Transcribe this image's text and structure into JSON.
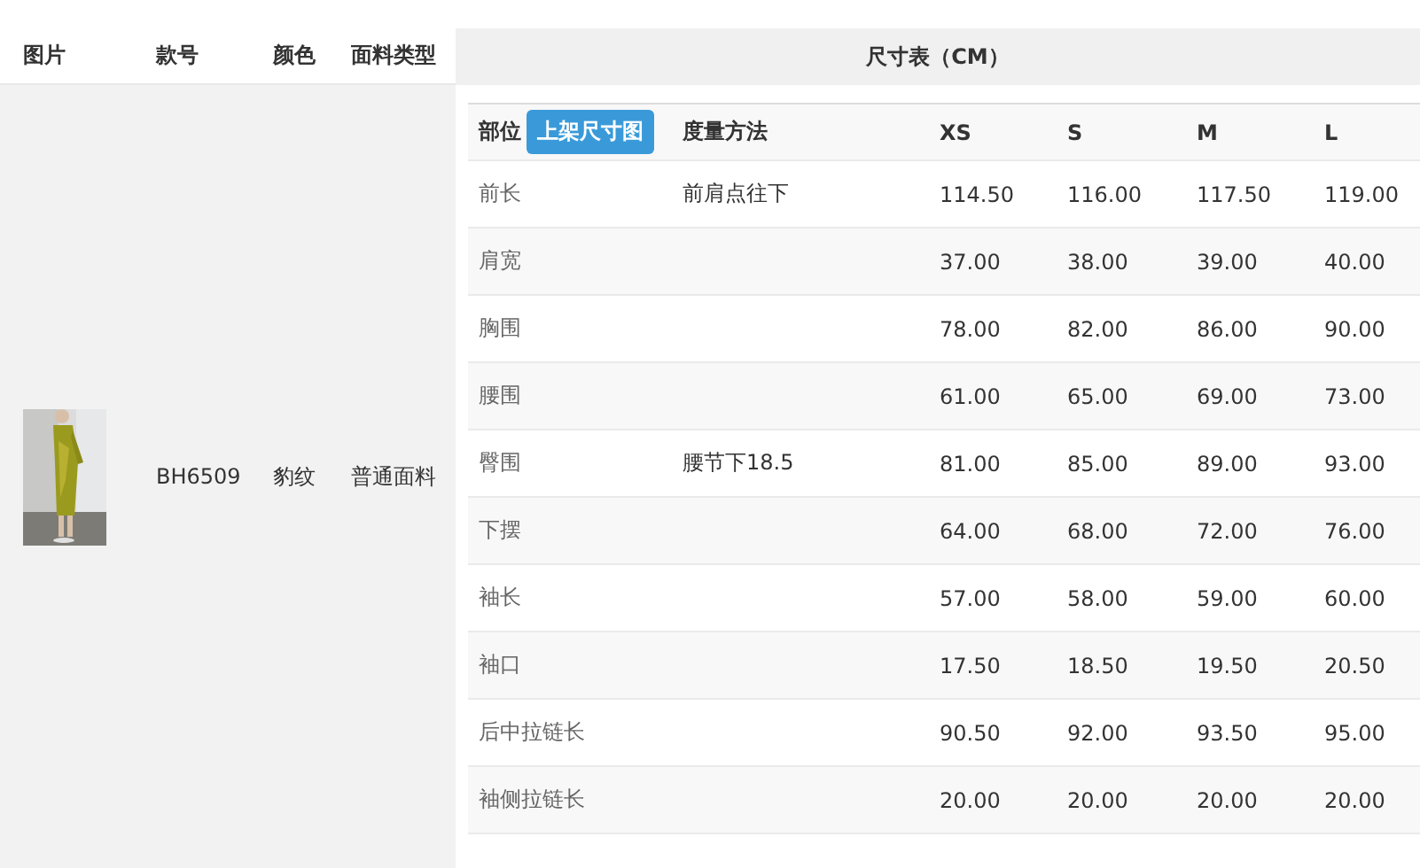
{
  "product_table": {
    "columns": [
      "图片",
      "款号",
      "颜色",
      "面料类型"
    ],
    "row": {
      "style_no": "BH6509",
      "color_name": "豹纹",
      "fabric": "普通面料"
    }
  },
  "size_chart": {
    "title": "尺寸表（CM）",
    "columns": [
      "部位",
      "度量方法",
      "XS",
      "S",
      "M",
      "L"
    ],
    "button": "上架尺寸图",
    "rows": [
      {
        "part": "前长",
        "method": "前肩点往下",
        "values": [
          "114.50",
          "116.00",
          "117.50",
          "119.00"
        ]
      },
      {
        "part": "肩宽",
        "values": [
          "37.00",
          "38.00",
          "39.00",
          "40.00"
        ]
      },
      {
        "part": "胸围",
        "values": [
          "78.00",
          "82.00",
          "86.00",
          "90.00"
        ]
      },
      {
        "part": "腰围",
        "values": [
          "61.00",
          "65.00",
          "69.00",
          "73.00"
        ]
      },
      {
        "part": "臀围",
        "method": "腰节下18.5",
        "values": [
          "81.00",
          "85.00",
          "89.00",
          "93.00"
        ]
      },
      {
        "part": "下摆",
        "values": [
          "64.00",
          "68.00",
          "72.00",
          "76.00"
        ]
      },
      {
        "part": "袖长",
        "values": [
          "57.00",
          "58.00",
          "59.00",
          "60.00"
        ]
      },
      {
        "part": "袖口",
        "values": [
          "17.50",
          "18.50",
          "19.50",
          "20.50"
        ]
      },
      {
        "part": "后中拉链长",
        "values": [
          "90.50",
          "92.00",
          "93.50",
          "95.00"
        ]
      },
      {
        "part": "袖侧拉链长",
        "values": [
          "20.00",
          "20.00",
          "20.00",
          "20.00"
        ]
      }
    ]
  }
}
